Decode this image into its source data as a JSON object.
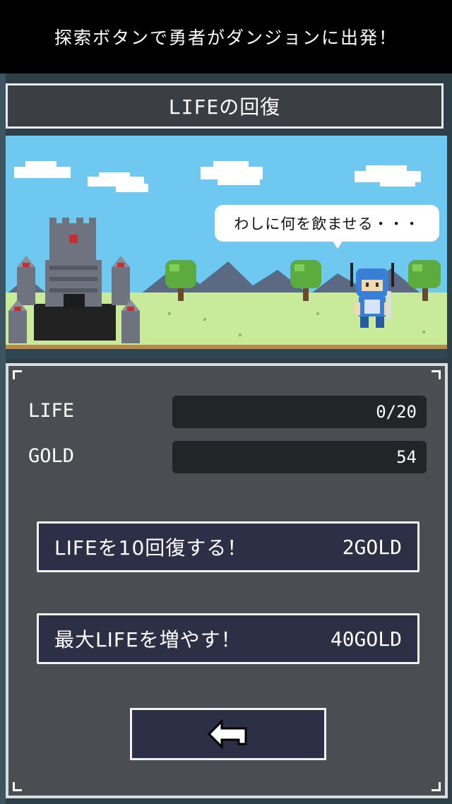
{
  "banner": {
    "text": "探索ボタンで勇者がダンジョンに出発！"
  },
  "title": {
    "text": "LIFEの回復"
  },
  "scene": {
    "speech": "わしに何を飲ませる・・・"
  },
  "stats": {
    "life_label": "LIFE",
    "life_value": "0/20",
    "gold_label": "GOLD",
    "gold_value": "54"
  },
  "actions": {
    "heal_label": "LIFEを10回復する！",
    "heal_cost": "2GOLD",
    "maxlife_label": "最大LIFEを増やす！",
    "maxlife_cost": "40GOLD"
  },
  "icons": {
    "back": "return-arrow-icon"
  },
  "colors": {
    "button_bg": "#2c2f45",
    "panel_bg": "#4a4d52",
    "sky": "#6ec8f0",
    "grass": "#c7ea9b"
  }
}
